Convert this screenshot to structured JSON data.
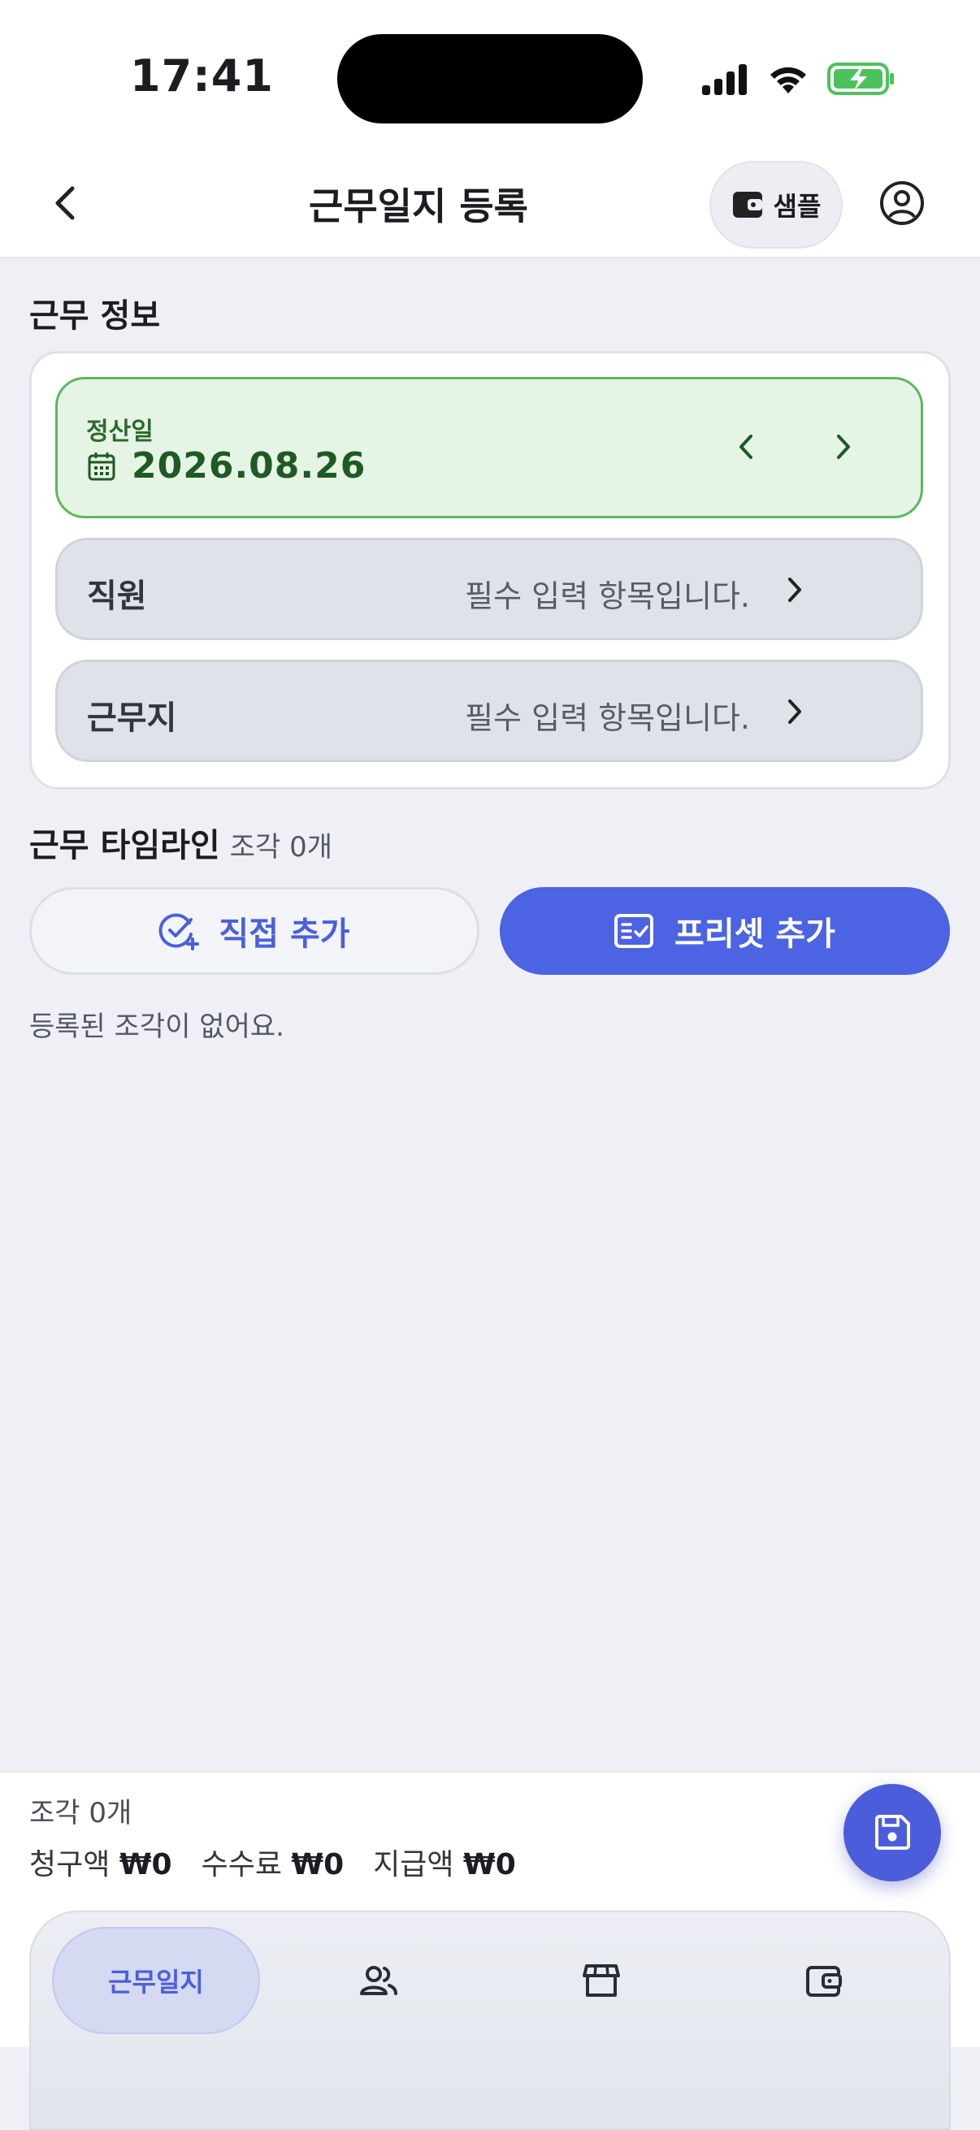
{
  "status_bar": {
    "time": "17:41"
  },
  "header": {
    "title": "근무일지 등록",
    "sample_label": "샘플"
  },
  "work_info": {
    "section_title": "근무 정보",
    "settlement_label": "정산일",
    "settlement_date": "2026.08.26",
    "fields": [
      {
        "label": "직원",
        "placeholder": "필수 입력 항목입니다."
      },
      {
        "label": "근무지",
        "placeholder": "필수 입력 항목입니다."
      }
    ]
  },
  "timeline": {
    "section_title": "근무 타임라인",
    "count_text": "조각 0개",
    "direct_add_label": "직접 추가",
    "preset_add_label": "프리셋 추가",
    "empty_text": "등록된 조각이 없어요."
  },
  "summary": {
    "count_text": "조각 0개",
    "claim_label": "청구액",
    "claim_value": "₩0",
    "fee_label": "수수료",
    "fee_value": "₩0",
    "pay_label": "지급액",
    "pay_value": "₩0"
  },
  "tabs": {
    "active_label": "근무일지"
  },
  "colors": {
    "accent": "#4c63e3",
    "date_green": "#1e5a22",
    "date_bg": "#e6f4e6"
  }
}
